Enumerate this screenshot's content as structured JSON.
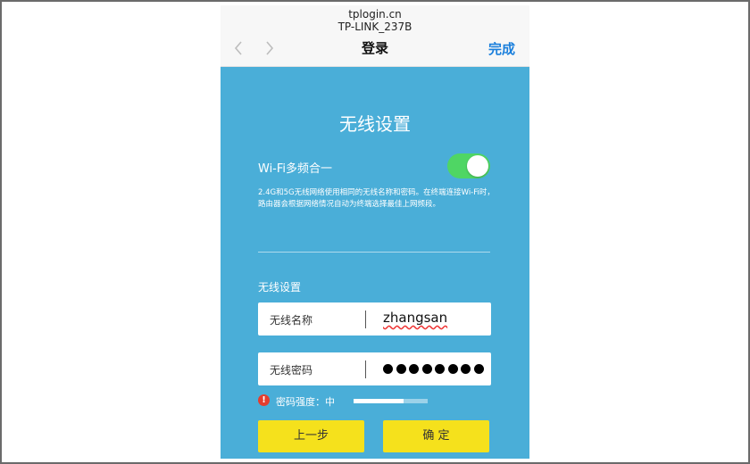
{
  "browser": {
    "url": "tplogin.cn",
    "page_subtitle": "TP-LINK_237B",
    "nav_title": "登录",
    "done_label": "完成"
  },
  "page": {
    "title": "无线设置",
    "wifi_merge": {
      "label": "Wi-Fi多频合一",
      "enabled": true,
      "description": "2.4G和5G无线网络使用相同的无线名称和密码。在终端连接Wi-Fi时，路由器会根据网络情况自动为终端选择最佳上网频段。"
    },
    "section_label": "无线设置",
    "ssid": {
      "label": "无线名称",
      "value": "zhangsan"
    },
    "password": {
      "label": "无线密码",
      "masked_length": 8
    },
    "strength": {
      "label": "密码强度：",
      "level": "中",
      "fill": 0.68
    },
    "buttons": {
      "prev": "上一步",
      "confirm": "确 定"
    }
  },
  "colors": {
    "panel_bg": "#4aaed8",
    "toggle_on": "#4fd664",
    "button_bg": "#f5e11c",
    "link_blue": "#1a7fdc",
    "warn_red": "#e53d2e"
  }
}
